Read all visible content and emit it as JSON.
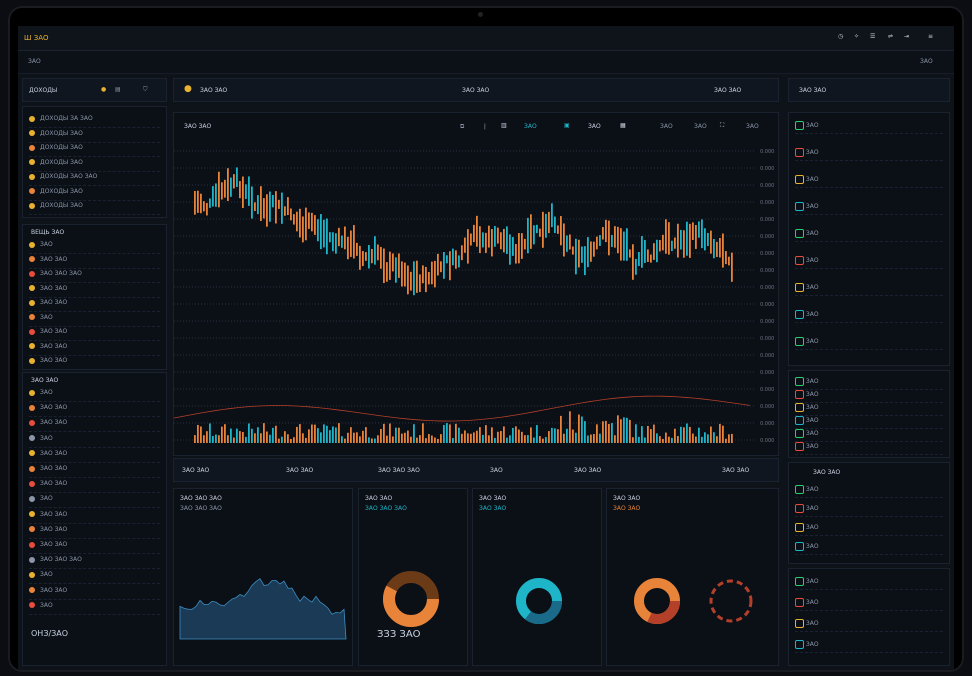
{
  "topbar": {
    "brand": "Ш ЗАО",
    "right_label": "≡"
  },
  "subbar": {
    "left": "ЗАО",
    "right": "ЗАО"
  },
  "left": {
    "header": "ДОХОДЫ",
    "group1": [
      "ДОХОДЫ ЗА ЗАО",
      "ДОХОДЫ ЗАО",
      "ДОХОДЫ ЗАО",
      "ДОХОДЫ ЗАО",
      "ДОХОДЫ ЗАО ЗАО",
      "ДОХОДЫ ЗАО",
      "ДОХОДЫ ЗАО"
    ],
    "group2_title": "ВЕЩЬ ЗАО",
    "group2": [
      "ЗАО",
      "ЗАО ЗАО",
      "ЗАО ЗАО ЗАО",
      "ЗАО ЗАО",
      "ЗАО ЗАО",
      "ЗАО",
      "ЗАО ЗАО",
      "ЗАО ЗАО",
      "ЗАО ЗАО"
    ],
    "group3_title": "ЗАО ЗАО",
    "group3": [
      "ЗАО",
      "ЗАО ЗАО",
      "ЗАО ЗАО",
      "ЗАО",
      "ЗАО ЗАО",
      "ЗАО ЗАО",
      "ЗАО ЗАО",
      "ЗАО",
      "ЗАО ЗАО",
      "ЗАО ЗАО",
      "ЗАО ЗАО",
      "ЗАО ЗАО ЗАО",
      "ЗАО",
      "ЗАО ЗАО",
      "ЗАО"
    ],
    "footer": "ОНЗ/ЗАО"
  },
  "main": {
    "header_title": "ЗАО ЗАО",
    "header_mid": "ЗАО ЗАО",
    "header_right": "ЗАО ЗАО",
    "chart_title": "ЗАО ЗАО",
    "toolbar": [
      "ЗАО",
      "ЗАО",
      "ЗАО",
      "ЗАО",
      "ЗАО"
    ],
    "price_ticks": [
      "0.000",
      "0.000",
      "0.000",
      "0.000",
      "0.000",
      "0.000",
      "0.000",
      "0.000",
      "0.000",
      "0.000",
      "0.000",
      "0.000",
      "0.000",
      "0.000",
      "0.000",
      "0.000",
      "0.000",
      "0.000"
    ],
    "stats": [
      "ЗАО ЗАО",
      "ЗАО ЗАО",
      "ЗАО ЗАО ЗАО",
      "ЗАО",
      "ЗАО ЗАО",
      "ЗАО ЗАО"
    ],
    "card1": {
      "title": "ЗАО ЗАО ЗАО",
      "sub": "ЗАО ЗАО ЗАО"
    },
    "card2": {
      "title": "ЗАО ЗАО",
      "sub": "ЗАО ЗАО ЗАО",
      "big": "ЗЗЗ ЗАО"
    },
    "card3": {
      "title": "ЗАО ЗАО",
      "sub": "ЗАО ЗАО"
    },
    "card4": {
      "title": "ЗАО ЗАО",
      "sub": "ЗАО ЗАО"
    }
  },
  "right": {
    "header": "ЗАО ЗАО",
    "rows1": [
      "ЗАО",
      "ЗАО",
      "ЗАО",
      "ЗАО",
      "ЗАО",
      "ЗАО",
      "ЗАО",
      "ЗАО",
      "ЗАО"
    ],
    "rows2": [
      "ЗАО",
      "ЗАО",
      "ЗАО",
      "ЗАО",
      "ЗАО",
      "ЗАО"
    ],
    "rows3_title": "ЗАО ЗАО",
    "rows3": [
      "ЗАО",
      "ЗАО",
      "ЗАО",
      "ЗАО"
    ],
    "rows4": [
      "ЗАО",
      "ЗАО",
      "ЗАО",
      "ЗАО"
    ]
  },
  "colors": {
    "accent": "#e8b231",
    "up": "#1fb5c9",
    "down": "#e8833a",
    "green": "#2ecc71",
    "red": "#e74c3c"
  }
}
